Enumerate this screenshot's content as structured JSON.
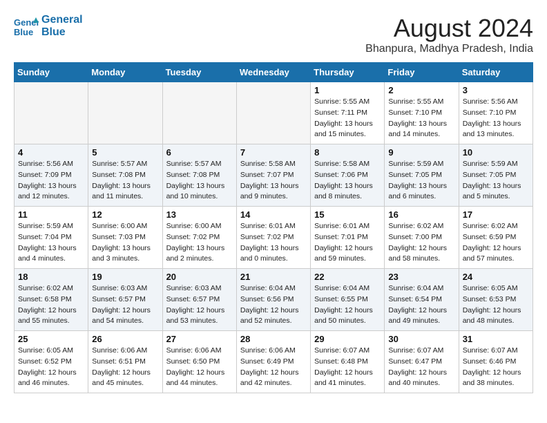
{
  "header": {
    "logo_line1": "General",
    "logo_line2": "Blue",
    "month_year": "August 2024",
    "location": "Bhanpura, Madhya Pradesh, India"
  },
  "weekdays": [
    "Sunday",
    "Monday",
    "Tuesday",
    "Wednesday",
    "Thursday",
    "Friday",
    "Saturday"
  ],
  "weeks": [
    [
      {
        "day": "",
        "info": "",
        "empty": true
      },
      {
        "day": "",
        "info": "",
        "empty": true
      },
      {
        "day": "",
        "info": "",
        "empty": true
      },
      {
        "day": "",
        "info": "",
        "empty": true
      },
      {
        "day": "1",
        "info": "Sunrise: 5:55 AM\nSunset: 7:11 PM\nDaylight: 13 hours\nand 15 minutes."
      },
      {
        "day": "2",
        "info": "Sunrise: 5:55 AM\nSunset: 7:10 PM\nDaylight: 13 hours\nand 14 minutes."
      },
      {
        "day": "3",
        "info": "Sunrise: 5:56 AM\nSunset: 7:10 PM\nDaylight: 13 hours\nand 13 minutes."
      }
    ],
    [
      {
        "day": "4",
        "info": "Sunrise: 5:56 AM\nSunset: 7:09 PM\nDaylight: 13 hours\nand 12 minutes."
      },
      {
        "day": "5",
        "info": "Sunrise: 5:57 AM\nSunset: 7:08 PM\nDaylight: 13 hours\nand 11 minutes."
      },
      {
        "day": "6",
        "info": "Sunrise: 5:57 AM\nSunset: 7:08 PM\nDaylight: 13 hours\nand 10 minutes."
      },
      {
        "day": "7",
        "info": "Sunrise: 5:58 AM\nSunset: 7:07 PM\nDaylight: 13 hours\nand 9 minutes."
      },
      {
        "day": "8",
        "info": "Sunrise: 5:58 AM\nSunset: 7:06 PM\nDaylight: 13 hours\nand 8 minutes."
      },
      {
        "day": "9",
        "info": "Sunrise: 5:59 AM\nSunset: 7:05 PM\nDaylight: 13 hours\nand 6 minutes."
      },
      {
        "day": "10",
        "info": "Sunrise: 5:59 AM\nSunset: 7:05 PM\nDaylight: 13 hours\nand 5 minutes."
      }
    ],
    [
      {
        "day": "11",
        "info": "Sunrise: 5:59 AM\nSunset: 7:04 PM\nDaylight: 13 hours\nand 4 minutes."
      },
      {
        "day": "12",
        "info": "Sunrise: 6:00 AM\nSunset: 7:03 PM\nDaylight: 13 hours\nand 3 minutes."
      },
      {
        "day": "13",
        "info": "Sunrise: 6:00 AM\nSunset: 7:02 PM\nDaylight: 13 hours\nand 2 minutes."
      },
      {
        "day": "14",
        "info": "Sunrise: 6:01 AM\nSunset: 7:02 PM\nDaylight: 13 hours\nand 0 minutes."
      },
      {
        "day": "15",
        "info": "Sunrise: 6:01 AM\nSunset: 7:01 PM\nDaylight: 12 hours\nand 59 minutes."
      },
      {
        "day": "16",
        "info": "Sunrise: 6:02 AM\nSunset: 7:00 PM\nDaylight: 12 hours\nand 58 minutes."
      },
      {
        "day": "17",
        "info": "Sunrise: 6:02 AM\nSunset: 6:59 PM\nDaylight: 12 hours\nand 57 minutes."
      }
    ],
    [
      {
        "day": "18",
        "info": "Sunrise: 6:02 AM\nSunset: 6:58 PM\nDaylight: 12 hours\nand 55 minutes."
      },
      {
        "day": "19",
        "info": "Sunrise: 6:03 AM\nSunset: 6:57 PM\nDaylight: 12 hours\nand 54 minutes."
      },
      {
        "day": "20",
        "info": "Sunrise: 6:03 AM\nSunset: 6:57 PM\nDaylight: 12 hours\nand 53 minutes."
      },
      {
        "day": "21",
        "info": "Sunrise: 6:04 AM\nSunset: 6:56 PM\nDaylight: 12 hours\nand 52 minutes."
      },
      {
        "day": "22",
        "info": "Sunrise: 6:04 AM\nSunset: 6:55 PM\nDaylight: 12 hours\nand 50 minutes."
      },
      {
        "day": "23",
        "info": "Sunrise: 6:04 AM\nSunset: 6:54 PM\nDaylight: 12 hours\nand 49 minutes."
      },
      {
        "day": "24",
        "info": "Sunrise: 6:05 AM\nSunset: 6:53 PM\nDaylight: 12 hours\nand 48 minutes."
      }
    ],
    [
      {
        "day": "25",
        "info": "Sunrise: 6:05 AM\nSunset: 6:52 PM\nDaylight: 12 hours\nand 46 minutes."
      },
      {
        "day": "26",
        "info": "Sunrise: 6:06 AM\nSunset: 6:51 PM\nDaylight: 12 hours\nand 45 minutes."
      },
      {
        "day": "27",
        "info": "Sunrise: 6:06 AM\nSunset: 6:50 PM\nDaylight: 12 hours\nand 44 minutes."
      },
      {
        "day": "28",
        "info": "Sunrise: 6:06 AM\nSunset: 6:49 PM\nDaylight: 12 hours\nand 42 minutes."
      },
      {
        "day": "29",
        "info": "Sunrise: 6:07 AM\nSunset: 6:48 PM\nDaylight: 12 hours\nand 41 minutes."
      },
      {
        "day": "30",
        "info": "Sunrise: 6:07 AM\nSunset: 6:47 PM\nDaylight: 12 hours\nand 40 minutes."
      },
      {
        "day": "31",
        "info": "Sunrise: 6:07 AM\nSunset: 6:46 PM\nDaylight: 12 hours\nand 38 minutes."
      }
    ]
  ]
}
